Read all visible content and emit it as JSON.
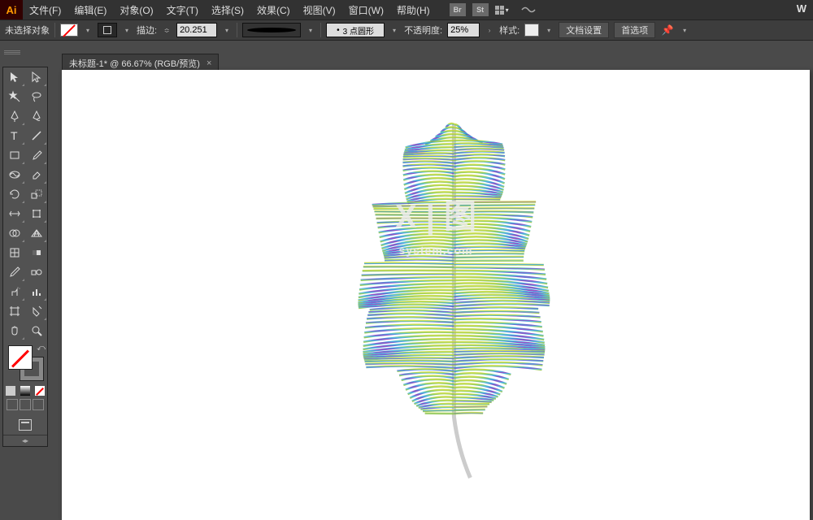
{
  "app": {
    "logo": "Ai",
    "rightChar": "W"
  },
  "menu": {
    "file": "文件(F)",
    "edit": "编辑(E)",
    "object": "对象(O)",
    "type": "文字(T)",
    "select": "选择(S)",
    "effect": "效果(C)",
    "view": "视图(V)",
    "window": "窗口(W)",
    "help": "帮助(H)",
    "br": "Br",
    "st": "St"
  },
  "controlbar": {
    "noSelection": "未选择对象",
    "strokeLabel": "描边:",
    "strokeWeight": "20.251",
    "brushLabel": "3 点圆形",
    "opacityLabel": "不透明度:",
    "opacityValue": "25%",
    "styleLabel": "样式:",
    "docSetup": "文档设置",
    "prefs": "首选项"
  },
  "tab": {
    "title": "未标题-1* @ 66.67% (RGB/预览)",
    "close": "×"
  },
  "watermark": {
    "line1": "X | 图",
    "line2": "system.com"
  },
  "hiddenBottom": "..."
}
